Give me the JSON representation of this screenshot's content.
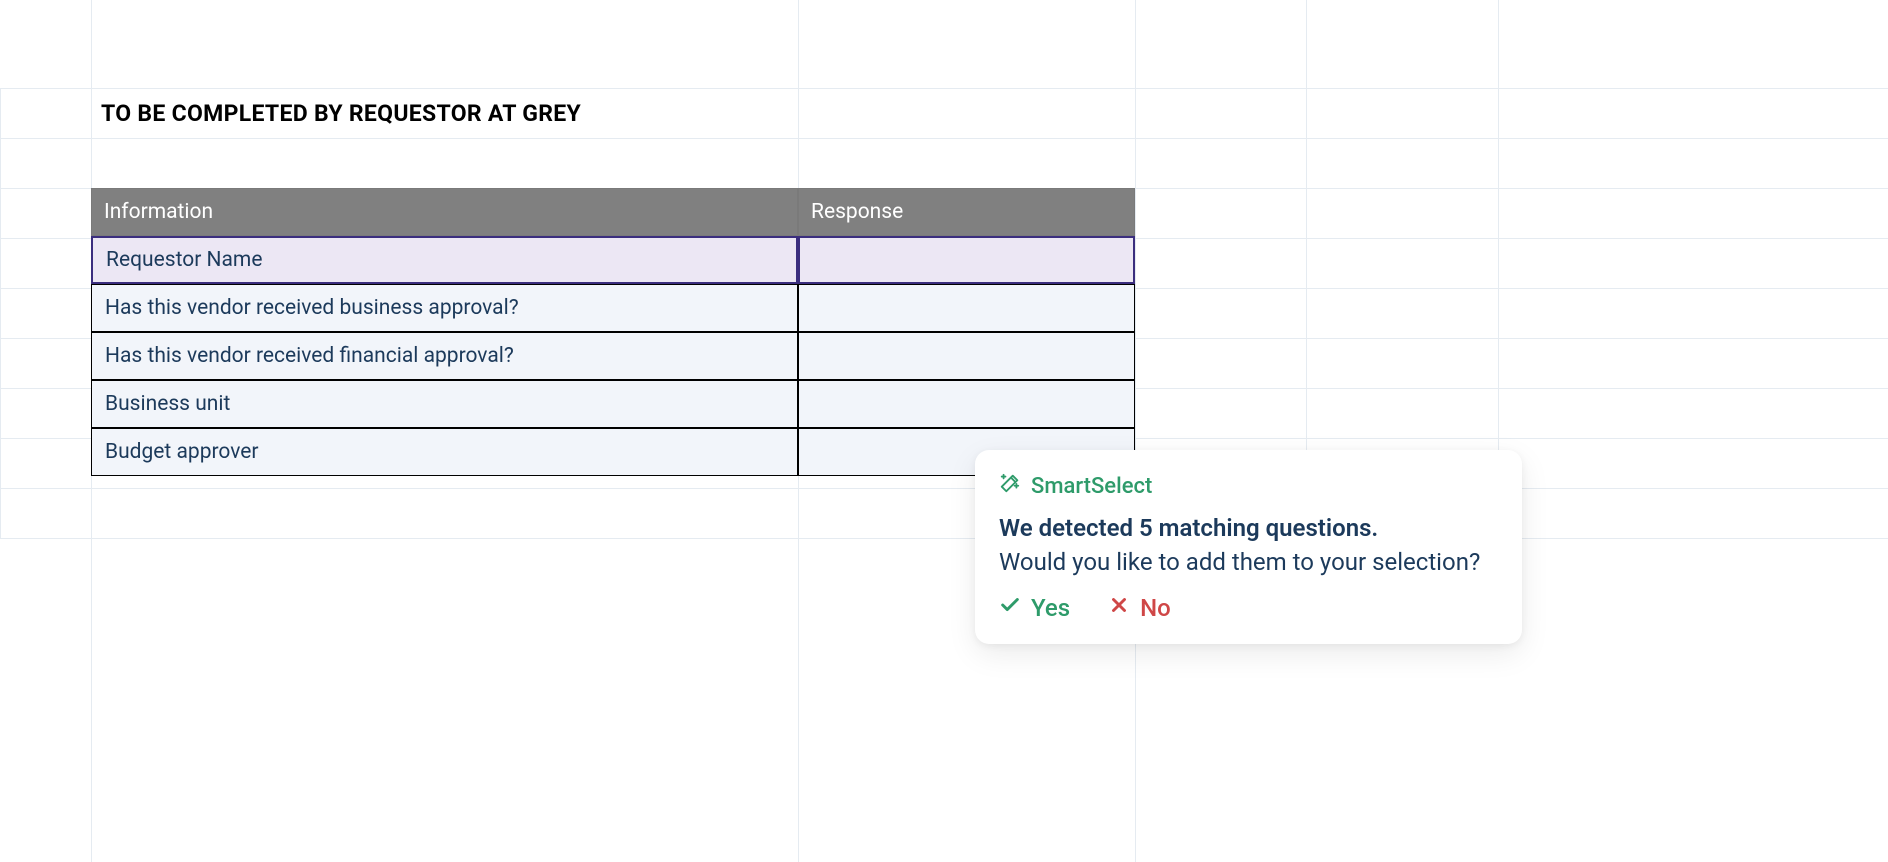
{
  "sheet": {
    "title": "TO BE COMPLETED BY REQUESTOR AT GREY",
    "columns": {
      "information": "Information",
      "response": "Response"
    },
    "rows": [
      {
        "information": "Requestor Name",
        "response": "",
        "selected": true
      },
      {
        "information": "Has this vendor received business approval?",
        "response": "",
        "selected": false
      },
      {
        "information": "Has this vendor received financial approval?",
        "response": "",
        "selected": false
      },
      {
        "information": "Business unit",
        "response": "",
        "selected": false
      },
      {
        "information": "Budget approver",
        "response": "",
        "selected": false
      }
    ]
  },
  "popup": {
    "brand": "SmartSelect",
    "line1": "We detected 5 matching questions.",
    "line2": "Would you like to add them to your selection?",
    "yes": "Yes",
    "no": "No"
  }
}
